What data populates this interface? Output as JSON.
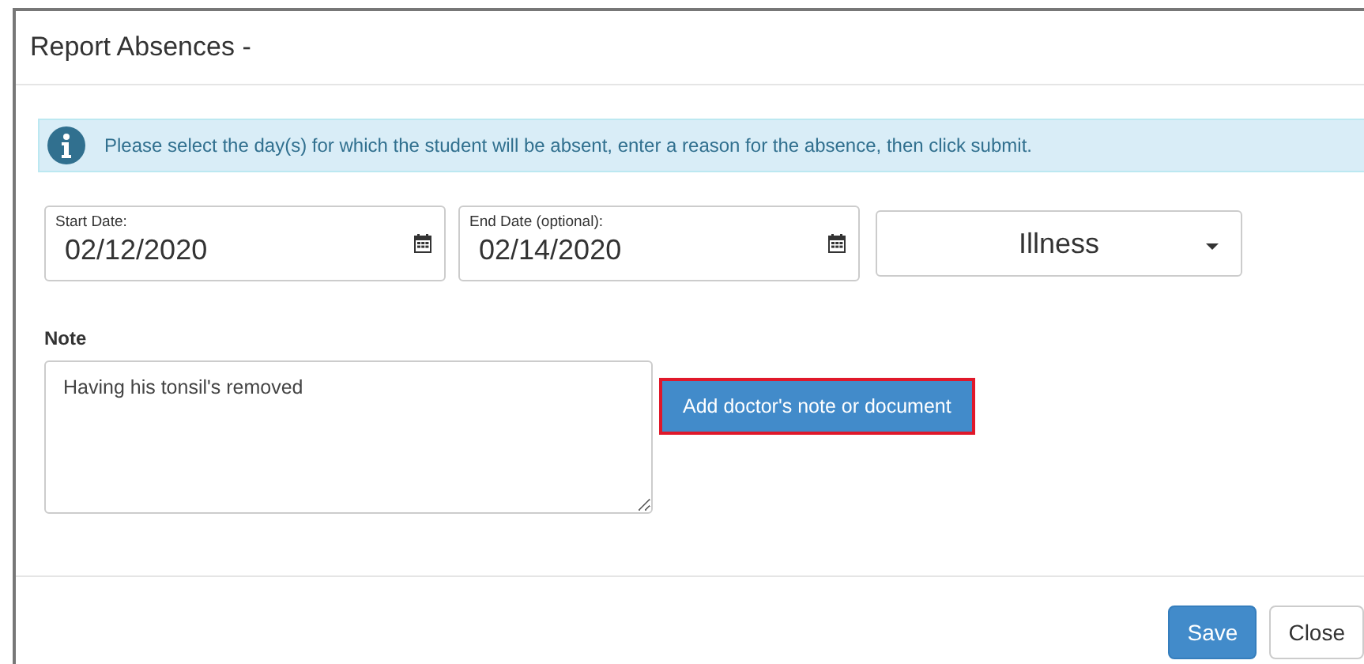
{
  "dialog": {
    "title": "Report Absences -"
  },
  "alert": {
    "text": "Please select the day(s) for which the student will be absent, enter a reason for the absence, then click submit."
  },
  "dates": [
    {
      "label": "Start Date:",
      "value": "02/12/2020"
    },
    {
      "label": "End Date (optional):",
      "value": "02/14/2020"
    }
  ],
  "reason": {
    "value": "Illness"
  },
  "note": {
    "label": "Note",
    "value": "Having his tonsil's removed"
  },
  "attach_button": {
    "label": "Add doctor's note or document",
    "highlighted": true
  },
  "buttons": [
    {
      "label": "Save",
      "kind": "primary"
    },
    {
      "label": "Close",
      "kind": "default"
    }
  ]
}
